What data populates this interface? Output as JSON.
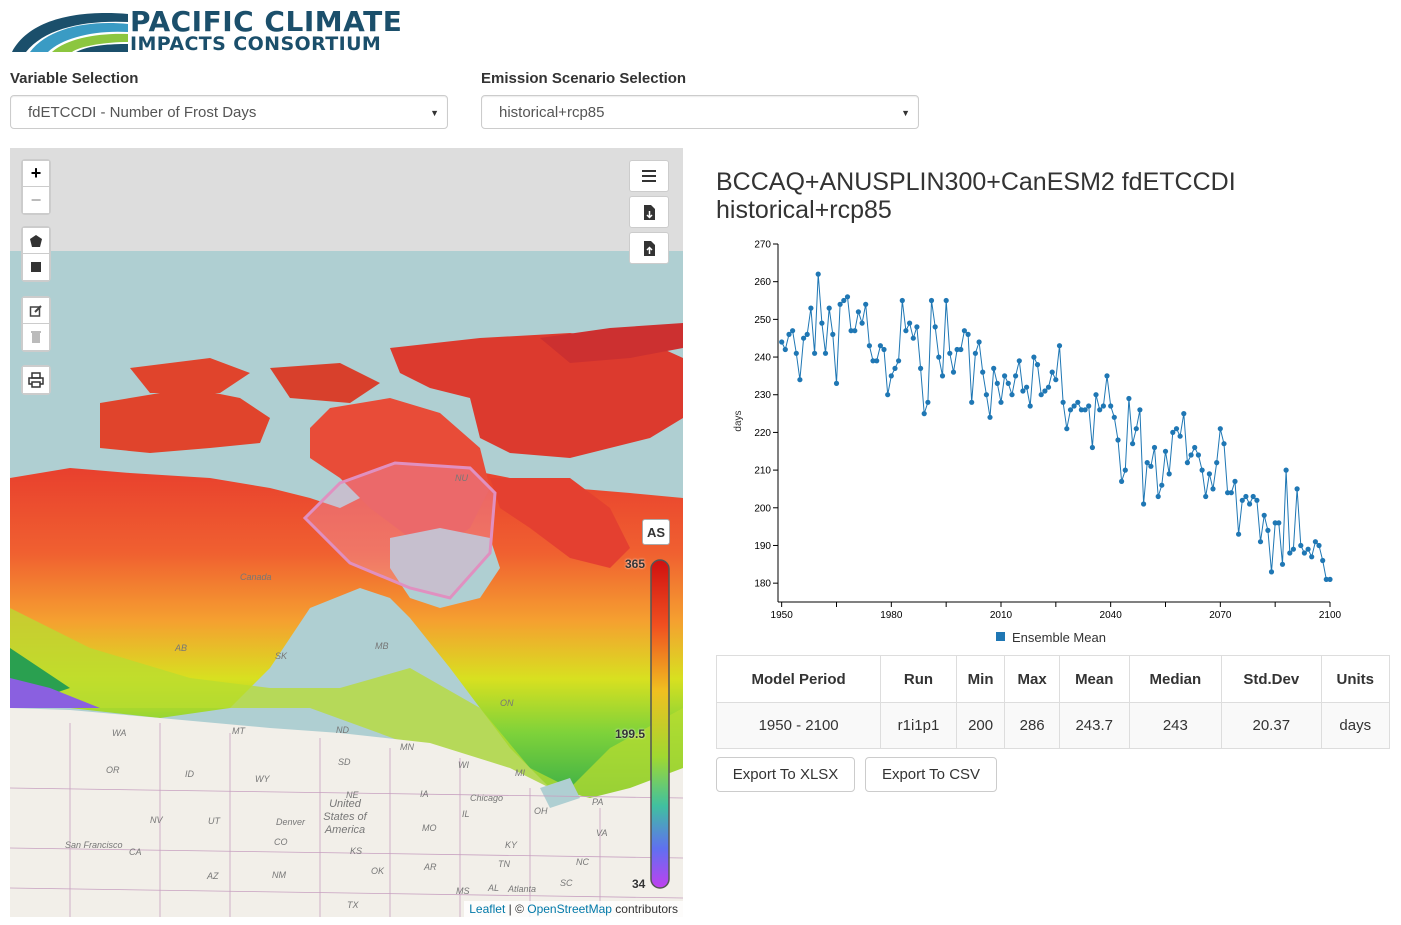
{
  "logo": {
    "line1": "PACIFIC CLIMATE",
    "line2": "IMPACTS CONSORTIUM"
  },
  "variable": {
    "label": "Variable Selection",
    "value": "fdETCCDI - Number of Frost Days"
  },
  "scenario": {
    "label": "Emission Scenario Selection",
    "value": "historical+rcp85"
  },
  "map": {
    "zoom_in": "+",
    "zoom_out": "−",
    "as_label": "AS",
    "colorbar": {
      "max": "365",
      "mid": "199.5",
      "min": "34"
    },
    "attribution": {
      "leaflet": "Leaflet",
      "sep": " | © ",
      "osm": "OpenStreetMap",
      "suffix": " contributors"
    },
    "place_labels": [
      "Canada",
      "AB",
      "SK",
      "MB",
      "ON",
      "NU",
      "WA",
      "MT",
      "ND",
      "MN",
      "WI",
      "MI",
      "OR",
      "ID",
      "WY",
      "SD",
      "IA",
      "NV",
      "UT",
      "NE",
      "IL",
      "OH",
      "PA",
      "CA",
      "CO",
      "KS",
      "MO",
      "KY",
      "NM",
      "OK",
      "AR",
      "TN",
      "NC",
      "AZ",
      "TX",
      "MS",
      "AL",
      "SC",
      "VA",
      "Denver",
      "Chicago",
      "Atlanta",
      "San Francisco",
      "United States of America"
    ]
  },
  "chart_data": {
    "type": "line",
    "title": "BCCAQ+ANUSPLIN300+CanESM2 fdETCCDI historical+rcp85",
    "ylabel": "days",
    "xlabel": "",
    "ylim": [
      175,
      270
    ],
    "xlim": [
      1949,
      2100
    ],
    "xticks": [
      1950,
      1980,
      2010,
      2040,
      2070,
      2100
    ],
    "yticks": [
      180,
      190,
      200,
      210,
      220,
      230,
      240,
      250,
      260,
      270
    ],
    "legend": "bottom-center",
    "series": [
      {
        "name": "Ensemble Mean",
        "color": "#1f77b4",
        "x": [
          1950,
          1951,
          1952,
          1953,
          1954,
          1955,
          1956,
          1957,
          1958,
          1959,
          1960,
          1961,
          1962,
          1963,
          1964,
          1965,
          1966,
          1967,
          1968,
          1969,
          1970,
          1971,
          1972,
          1973,
          1974,
          1975,
          1976,
          1977,
          1978,
          1979,
          1980,
          1981,
          1982,
          1983,
          1984,
          1985,
          1986,
          1987,
          1988,
          1989,
          1990,
          1991,
          1992,
          1993,
          1994,
          1995,
          1996,
          1997,
          1998,
          1999,
          2000,
          2001,
          2002,
          2003,
          2004,
          2005,
          2006,
          2007,
          2008,
          2009,
          2010,
          2011,
          2012,
          2013,
          2014,
          2015,
          2016,
          2017,
          2018,
          2019,
          2020,
          2021,
          2022,
          2023,
          2024,
          2025,
          2026,
          2027,
          2028,
          2029,
          2030,
          2031,
          2032,
          2033,
          2034,
          2035,
          2036,
          2037,
          2038,
          2039,
          2040,
          2041,
          2042,
          2043,
          2044,
          2045,
          2046,
          2047,
          2048,
          2049,
          2050,
          2051,
          2052,
          2053,
          2054,
          2055,
          2056,
          2057,
          2058,
          2059,
          2060,
          2061,
          2062,
          2063,
          2064,
          2065,
          2066,
          2067,
          2068,
          2069,
          2070,
          2071,
          2072,
          2073,
          2074,
          2075,
          2076,
          2077,
          2078,
          2079,
          2080,
          2081,
          2082,
          2083,
          2084,
          2085,
          2086,
          2087,
          2088,
          2089,
          2090,
          2091,
          2092,
          2093,
          2094,
          2095,
          2096,
          2097,
          2098,
          2099,
          2100
        ],
        "y": [
          244,
          242,
          246,
          247,
          241,
          234,
          245,
          246,
          253,
          241,
          262,
          249,
          241,
          253,
          246,
          233,
          254,
          255,
          256,
          247,
          247,
          252,
          249,
          254,
          243,
          239,
          239,
          243,
          242,
          230,
          235,
          237,
          239,
          255,
          247,
          249,
          245,
          248,
          237,
          225,
          228,
          255,
          248,
          240,
          235,
          255,
          241,
          236,
          242,
          242,
          247,
          246,
          228,
          241,
          244,
          236,
          230,
          224,
          237,
          233,
          228,
          235,
          233,
          230,
          235,
          239,
          231,
          232,
          227,
          240,
          238,
          230,
          231,
          232,
          236,
          234,
          243,
          228,
          221,
          226,
          227,
          228,
          226,
          226,
          227,
          216,
          230,
          226,
          227,
          235,
          227,
          224,
          218,
          207,
          210,
          229,
          217,
          221,
          226,
          201,
          212,
          211,
          216,
          203,
          206,
          215,
          209,
          220,
          221,
          219,
          225,
          212,
          214,
          216,
          214,
          210,
          203,
          209,
          205,
          212,
          221,
          217,
          204,
          204,
          207,
          193,
          202,
          203,
          201,
          203,
          202,
          191,
          198,
          194,
          183,
          196,
          196,
          185,
          210,
          188,
          189,
          205,
          190,
          188,
          189,
          187,
          191,
          190,
          186,
          181,
          181
        ]
      }
    ]
  },
  "table": {
    "headers": [
      "Model Period",
      "Run",
      "Min",
      "Max",
      "Mean",
      "Median",
      "Std.Dev",
      "Units"
    ],
    "row": [
      "1950 - 2100",
      "r1i1p1",
      "200",
      "286",
      "243.7",
      "243",
      "20.37",
      "days"
    ]
  },
  "export": {
    "xlsx": "Export To XLSX",
    "csv": "Export To CSV"
  }
}
